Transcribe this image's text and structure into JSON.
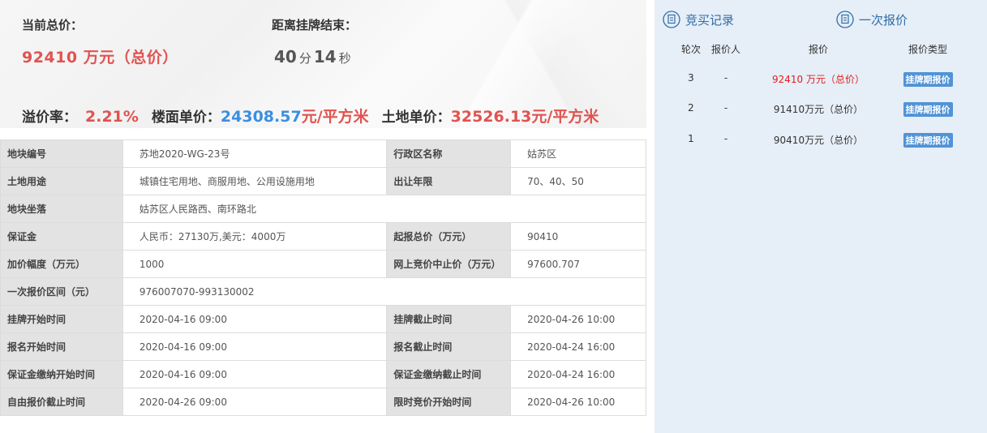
{
  "header": {
    "price_label": "当前总价：",
    "price_value": "92410 万元（总价）",
    "countdown_label": "距离挂牌结束：",
    "minutes": "40",
    "minutes_unit": "分",
    "seconds": "14",
    "seconds_unit": "秒",
    "premium_label": "溢价率：",
    "premium_value": "2.21%",
    "floor_label": "楼面单价：",
    "floor_value_num": "24308.57",
    "floor_value_unit": "元/平方米",
    "land_label": "土地单价：",
    "land_value": "32526.13元/平方米"
  },
  "table": {
    "r1": {
      "k1": "地块编号",
      "v1": "苏地2020-WG-23号",
      "k2": "行政区名称",
      "v2": "姑苏区"
    },
    "r2": {
      "k1": "土地用途",
      "v1": "城镇住宅用地、商服用地、公用设施用地",
      "k2": "出让年限",
      "v2": "70、40、50"
    },
    "r3": {
      "k1": "地块坐落",
      "v1": "姑苏区人民路西、南环路北"
    },
    "r4": {
      "k1": "保证金",
      "v1": "人民币：27130万,美元：4000万",
      "k2": "起报总价（万元）",
      "v2": "90410"
    },
    "r5": {
      "k1": "加价幅度（万元）",
      "v1": "1000",
      "k2": "网上竞价中止价（万元）",
      "v2": "97600.707"
    },
    "r6": {
      "k1": "一次报价区间（元）",
      "v1": "976007070-993130002"
    },
    "r7": {
      "k1": "挂牌开始时间",
      "v1": "2020-04-16 09:00",
      "k2": "挂牌截止时间",
      "v2": "2020-04-26 10:00"
    },
    "r8": {
      "k1": "报名开始时间",
      "v1": "2020-04-16 09:00",
      "k2": "报名截止时间",
      "v2": "2020-04-24 16:00"
    },
    "r9": {
      "k1": "保证金缴纳开始时间",
      "v1": "2020-04-16 09:00",
      "k2": "保证金缴纳截止时间",
      "v2": "2020-04-24 16:00"
    },
    "r10": {
      "k1": "自由报价截止时间",
      "v1": "2020-04-26 09:00",
      "k2": "限时竞价开始时间",
      "v2": "2020-04-26 10:00"
    }
  },
  "panel": {
    "tab_records": "竞买记录",
    "tab_once": "一次报价",
    "cols": {
      "round": "轮次",
      "bidder": "报价人",
      "price": "报价",
      "type": "报价类型"
    },
    "rows": [
      {
        "round": "3",
        "bidder": "-",
        "price": "92410 万元（总价）",
        "type": "挂牌期报价"
      },
      {
        "round": "2",
        "bidder": "-",
        "price": "91410万元（总价）",
        "type": "挂牌期报价"
      },
      {
        "round": "1",
        "bidder": "-",
        "price": "90410万元（总价）",
        "type": "挂牌期报价"
      }
    ]
  },
  "colors": {
    "accent_red": "#e05350",
    "accent_blue": "#3b8fe0",
    "badge": "#5193d6",
    "panel_bg": "#e6eef7"
  }
}
